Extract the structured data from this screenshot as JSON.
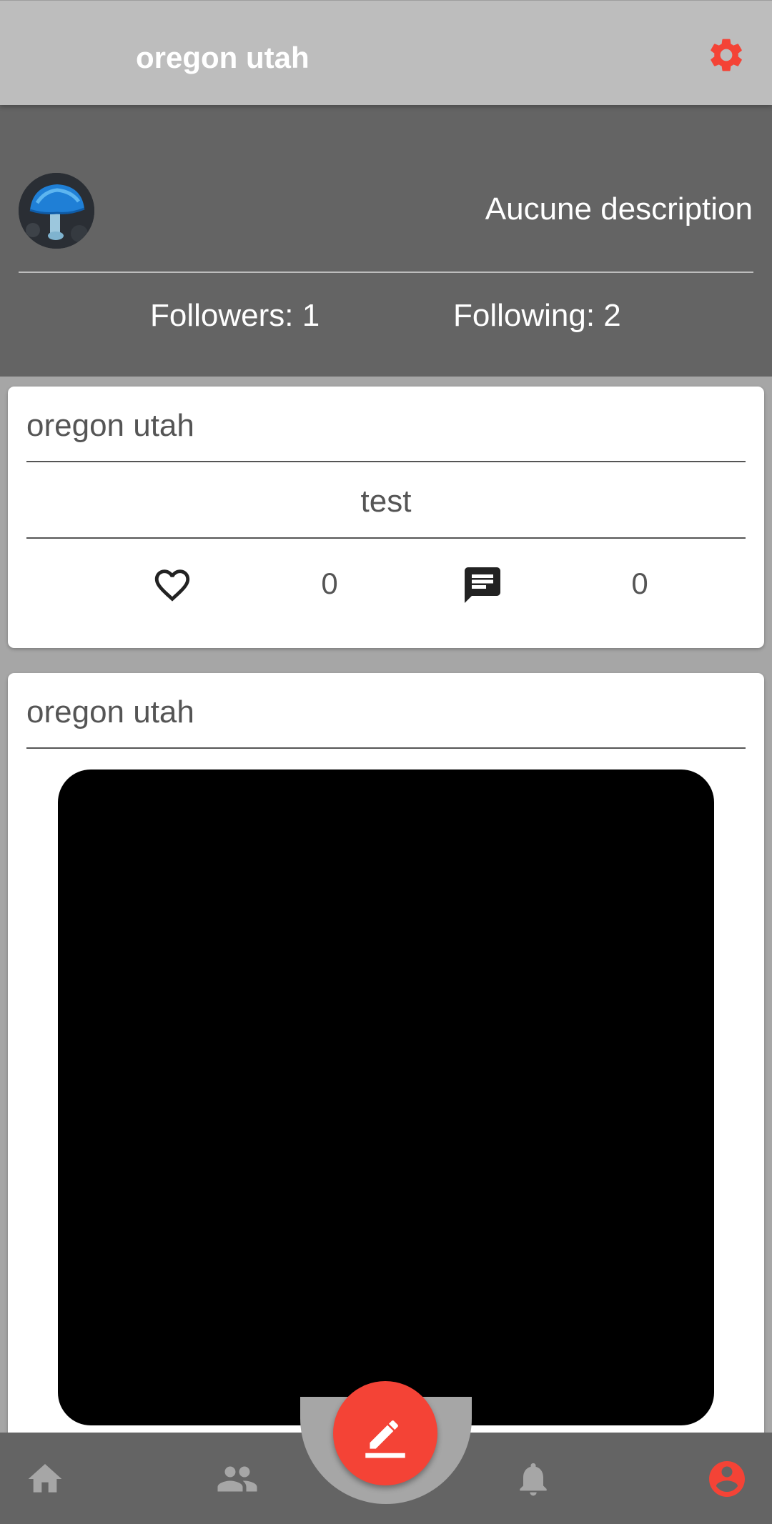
{
  "appbar": {
    "title": "oregon utah",
    "settings_icon": "gear-icon"
  },
  "profile": {
    "description": "Aucune description",
    "followers_label": "Followers: 1",
    "following_label": "Following: 2"
  },
  "posts": [
    {
      "author": "oregon utah",
      "text": "test",
      "like_count": "0",
      "comment_count": "0"
    },
    {
      "author": "oregon utah"
    }
  ],
  "bottom_nav": {
    "items": [
      "home-icon",
      "people-icon",
      "compose-icon",
      "bell-icon",
      "account-icon"
    ],
    "active": "account-icon"
  },
  "colors": {
    "accent": "#f44336",
    "appbar": "#bdbdbd",
    "header": "#646464",
    "nav": "#646464",
    "nav_icon": "#a6a6a6"
  }
}
